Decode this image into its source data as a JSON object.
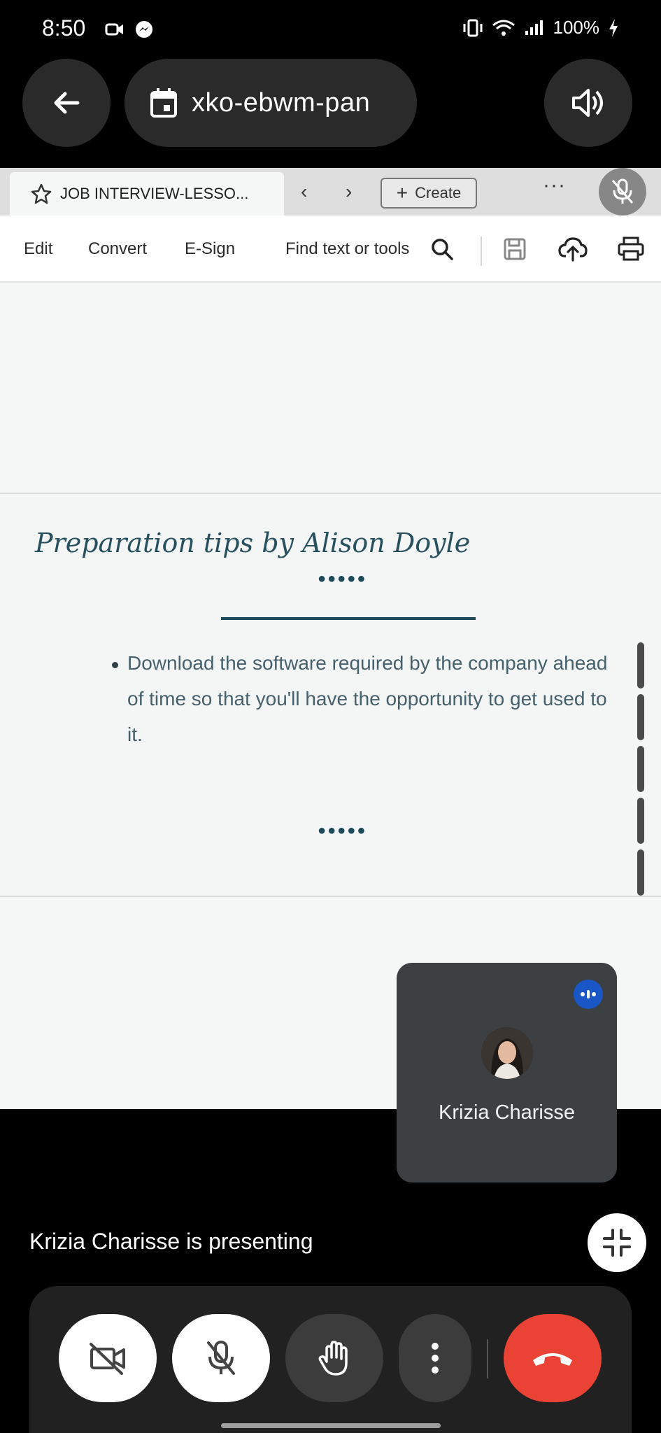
{
  "status_bar": {
    "time": "8:50",
    "battery": "100%",
    "icons": [
      "video-call-icon",
      "messenger-icon",
      "vibrate-icon",
      "wifi-icon",
      "signal-icon",
      "charging-icon"
    ]
  },
  "meet_header": {
    "meeting_code": "xko-ebwm-pan",
    "icons": [
      "back-arrow-icon",
      "calendar-icon",
      "volume-icon"
    ]
  },
  "browser": {
    "active_tab": "JOB INTERVIEW-LESSO...",
    "create_label": "Create",
    "more_label": "···"
  },
  "pdf_toolbar": {
    "edit": "Edit",
    "convert": "Convert",
    "esign": "E-Sign",
    "find": "Find text or tools"
  },
  "slide": {
    "title": "Preparation tips by Alison Doyle",
    "dots": "●●●●●",
    "bullet_1": "Download the software required by the company ahead of time so that you'll have the opportunity to get used to it.",
    "bullet_2": ""
  },
  "participant": {
    "name": "Krizia Charisse"
  },
  "presenting_text": "Krizia Charisse is presenting",
  "controls": [
    "camera-off-button",
    "mic-off-button",
    "raise-hand-button",
    "more-options-button",
    "end-call-button"
  ],
  "colors": {
    "end_call": "#ea4335",
    "slide_accent": "#1f4a5a",
    "speaking_badge": "#1a56c6"
  }
}
